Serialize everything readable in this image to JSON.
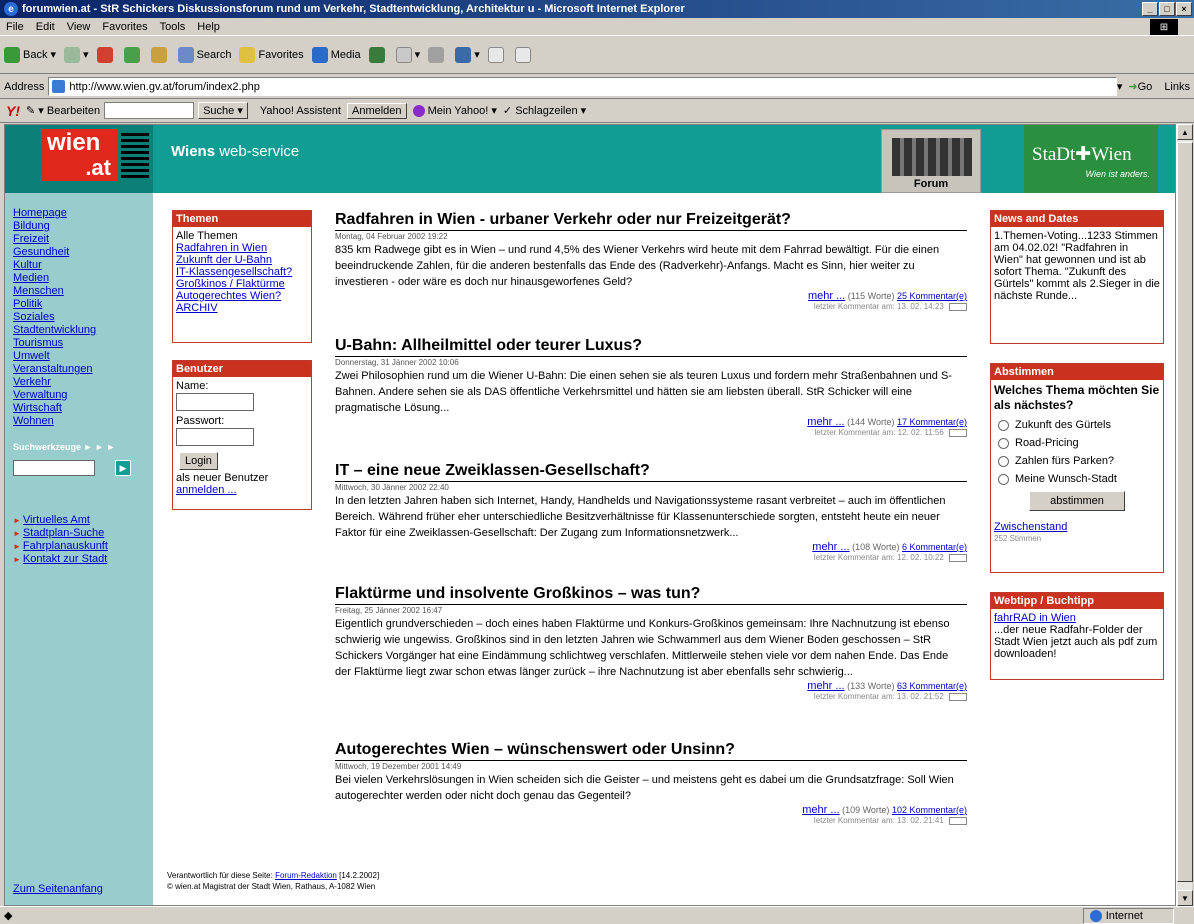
{
  "window": {
    "title": "forumwien.at - StR Schickers Diskussionsforum rund um Verkehr, Stadtentwicklung, Architektur u - Microsoft Internet Explorer",
    "controls": [
      "_",
      "□",
      "×"
    ]
  },
  "menu": [
    "File",
    "Edit",
    "View",
    "Favorites",
    "Tools",
    "Help"
  ],
  "toolbar": {
    "back": "Back",
    "search": "Search",
    "favorites": "Favorites",
    "media": "Media"
  },
  "address": {
    "label": "Address",
    "url": "http://www.wien.gv.at/forum/index2.php",
    "go": "Go",
    "links": "Links"
  },
  "yahoo": {
    "logo": "Y!",
    "bearbeiten": "Bearbeiten",
    "suche": "Suche",
    "assistent": "Yahoo! Assistent",
    "anmelden": "Anmelden",
    "mein_yahoo": "Mein Yahoo!",
    "schlagzeilen": "Schlagzeilen"
  },
  "header": {
    "logo_top": "wien",
    "logo_bottom": ".at",
    "title_bold": "Wiens",
    "title_light": "web-service",
    "forum_label": "Forum",
    "stadt": "StaDt✚Wien",
    "stadt_tagline": "Wien ist anders."
  },
  "nav": {
    "links": [
      "Homepage",
      "Bildung",
      "Freizeit",
      "Gesundheit",
      "Kultur",
      "Medien",
      "Menschen",
      "Politik",
      "Soziales",
      "Stadtentwicklung",
      "Tourismus",
      "Umwelt",
      "Veranstaltungen",
      "Verkehr",
      "Verwaltung",
      "Wirtschaft",
      "Wohnen"
    ],
    "search_label": "Suchwerkzeuge ► ► ►",
    "services": [
      "Virtuelles Amt",
      "Stadtplan-Suche",
      "Fahrplanauskunft",
      "Kontakt zur Stadt"
    ],
    "top": "Zum Seitenanfang"
  },
  "themen": {
    "title": "Themen",
    "all": "Alle Themen",
    "items": [
      "Radfahren in Wien",
      "Zukunft der U-Bahn",
      "IT-Klassengesellschaft?",
      "Großkinos / Flaktürme",
      "Autogerechtes Wien?",
      "ARCHIV"
    ]
  },
  "benutzer": {
    "title": "Benutzer",
    "name_label": "Name:",
    "password_label": "Passwort:",
    "login": "Login",
    "new_user": "als neuer Benutzer",
    "register": "anmelden ..."
  },
  "articles": [
    {
      "title": "Radfahren in Wien - urbaner Verkehr oder nur Freizeitgerät?",
      "date": "Montag, 04 Februar 2002 19:22",
      "text": "835 km Radwege gibt es in Wien – und rund 4,5% des Wiener Verkehrs wird heute mit dem Fahrrad bewältigt. Für die einen beeindruckende Zahlen, für die anderen bestenfalls das Ende des (Radverkehr)-Anfangs. Macht es Sinn, hier weiter zu investieren - oder wäre es doch nur hinausgeworfenes Geld?",
      "more": "mehr ...",
      "words": "(115 Worte)",
      "comments": "25 Kommentar(e)",
      "last": "letzter Kommentar am: 13. 02. 14:23"
    },
    {
      "title": "U-Bahn: Allheilmittel oder teurer Luxus?",
      "date": "Donnerstag, 31 Jänner 2002 10:06",
      "text": "Zwei Philosophien rund um die Wiener U-Bahn: Die einen sehen sie als teuren Luxus und fordern mehr Straßenbahnen und S-Bahnen. Andere sehen sie als DAS öffentliche Verkehrsmittel und hätten sie am liebsten überall. StR Schicker will eine pragmatische Lösung...",
      "more": "mehr ...",
      "words": "(144 Worte)",
      "comments": "17 Kommentar(e)",
      "last": "letzter Kommentar am: 12. 02. 11:56"
    },
    {
      "title": "IT – eine neue Zweiklassen-Gesellschaft?",
      "date": "Mittwoch, 30 Jänner 2002 22:40",
      "text": "In den letzten Jahren haben sich Internet, Handy, Handhelds und Navigationssysteme rasant verbreitet – auch im öffentlichen Bereich. Während früher eher unterschiedliche Besitzverhältnisse für Klassenunterschiede sorgten, entsteht heute ein neuer Faktor für eine Zweiklassen-Gesellschaft: Der Zugang zum Informationsnetzwerk...",
      "more": "mehr ...",
      "words": "(108 Worte)",
      "comments": "6 Kommentar(e)",
      "last": "letzter Kommentar am: 12. 02. 10:22"
    },
    {
      "title": "Flaktürme und insolvente Großkinos – was tun?",
      "date": "Freitag, 25 Jänner 2002 16:47",
      "text": "Eigentlich grundverschieden – doch eines haben Flaktürme und Konkurs-Großkinos gemeinsam: Ihre Nachnutzung ist ebenso schwierig wie ungewiss. Großkinos sind in den letzten Jahren wie Schwammerl aus dem Wiener Boden geschossen – StR Schickers Vorgänger hat eine Eindämmung schlichtweg verschlafen. Mittlerweile stehen viele vor dem nahen Ende. Das Ende der Flaktürme liegt zwar schon etwas länger zurück – ihre Nachnutzung ist aber ebenfalls sehr schwierig...",
      "more": "mehr ...",
      "words": "(133 Worte)",
      "comments": "63 Kommentar(e)",
      "last": "letzter Kommentar am: 13. 02. 21:52"
    },
    {
      "title": "Autogerechtes Wien – wünschenswert oder Unsinn?",
      "date": "Mittwoch, 19 Dezember 2001 14:49",
      "text": "Bei vielen Verkehrslösungen in Wien scheiden sich die Geister – und meistens geht es dabei um die Grundsatzfrage: Soll Wien autogerechter werden oder nicht doch genau das Gegenteil?",
      "more": "mehr ...",
      "words": "(109 Worte)",
      "comments": "102 Kommentar(e)",
      "last": "letzter Kommentar am: 13. 02. 21:41"
    }
  ],
  "news": {
    "title": "News and Dates",
    "text": "1.Themen-Voting...1233 Stimmen am 04.02.02! \"Radfahren in Wien\" hat gewonnen und ist ab sofort Thema. \"Zukunft des Gürtels\" kommt als 2.Sieger in die nächste Runde..."
  },
  "poll": {
    "title": "Abstimmen",
    "question": "Welches Thema möchten Sie als nächstes?",
    "options": [
      "Zukunft des Gürtels",
      "Road-Pricing",
      "Zahlen fürs Parken?",
      "Meine Wunsch-Stadt"
    ],
    "vote": "abstimmen",
    "result_link": "Zwischenstand",
    "votes": "252 Stimmen"
  },
  "webtipp": {
    "title": "Webtipp / Buchtipp",
    "link": "fahrRAD in Wien",
    "text": "...der neue Radfahr-Folder der Stadt Wien jetzt auch als pdf zum downloaden!"
  },
  "footer": {
    "responsible": "Verantwortlich für diese Seite:",
    "editor_link": "Forum-Redaktion",
    "date": "[14.2.2002]",
    "copyright": "© wien.at Magistrat der Stadt Wien, Rathaus, A-1082 Wien"
  },
  "status": {
    "zone": "Internet"
  }
}
